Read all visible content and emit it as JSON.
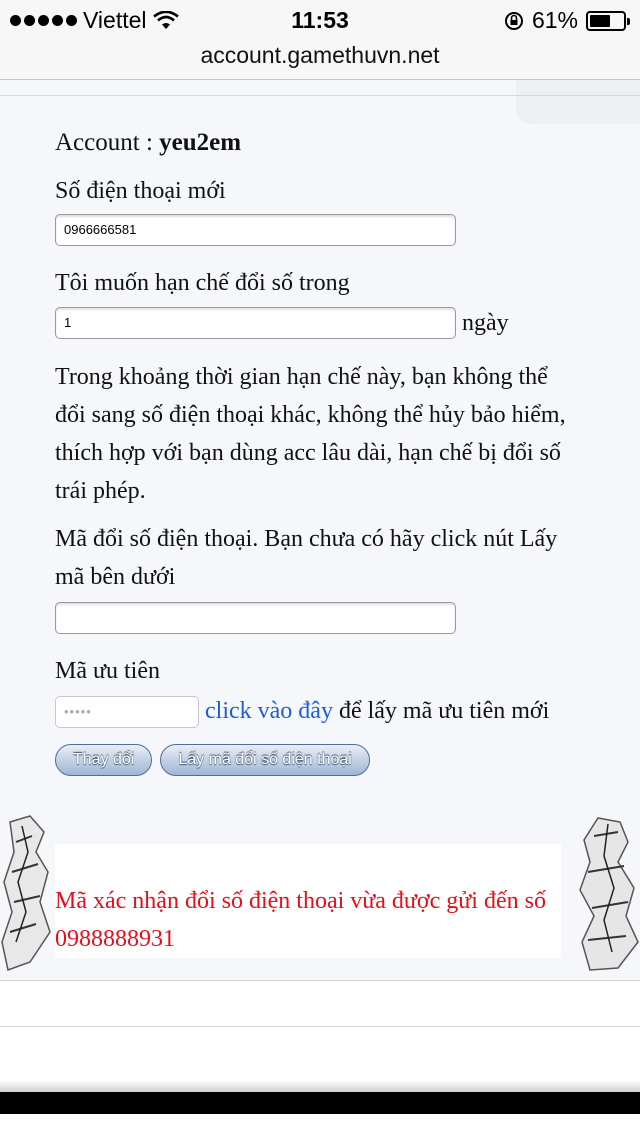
{
  "status": {
    "carrier": "Viettel",
    "time": "11:53",
    "battery_percent_label": "61%",
    "battery_level": 0.61,
    "icons": [
      "signal-dots-icon",
      "wifi-icon",
      "rotation-lock-icon",
      "battery-icon"
    ]
  },
  "browser": {
    "url": "account.gamethuvn.net"
  },
  "form": {
    "account_label": "Account : ",
    "account_name": "yeu2em",
    "new_phone_label": "Số điện thoại mới",
    "new_phone_value": "0966666581",
    "limit_label": "Tôi muốn hạn chế đổi số trong",
    "limit_value": "1",
    "limit_unit": "ngày",
    "limit_description": "Trong khoảng thời gian hạn chế này, bạn không thể đổi sang số điện thoại khác, không thể hủy bảo hiểm, thích hợp với bạn dùng acc lâu dài, hạn chế bị đổi số trái phép.",
    "code_label": "Mã đổi số điện thoại. Bạn chưa có hãy click nút Lấy mã bên dưới",
    "code_value": "",
    "priority_label": "Mã ưu tiên",
    "priority_value": "•••••",
    "priority_link": "click vào đây",
    "priority_suffix": " để lấy mã ưu tiên mới",
    "change_button": "Thay đổi",
    "get_code_button": "Lấy mã đổi số điện thoại"
  },
  "notice": {
    "message": "Mã xác nhận đổi số điện thoại vừa được gửi đến số 0988888931",
    "color": "#e1101b"
  },
  "colors": {
    "link": "#1a5fd6",
    "button_gradient_top": "#e9eef6",
    "button_gradient_bottom": "#9fb5d3"
  }
}
